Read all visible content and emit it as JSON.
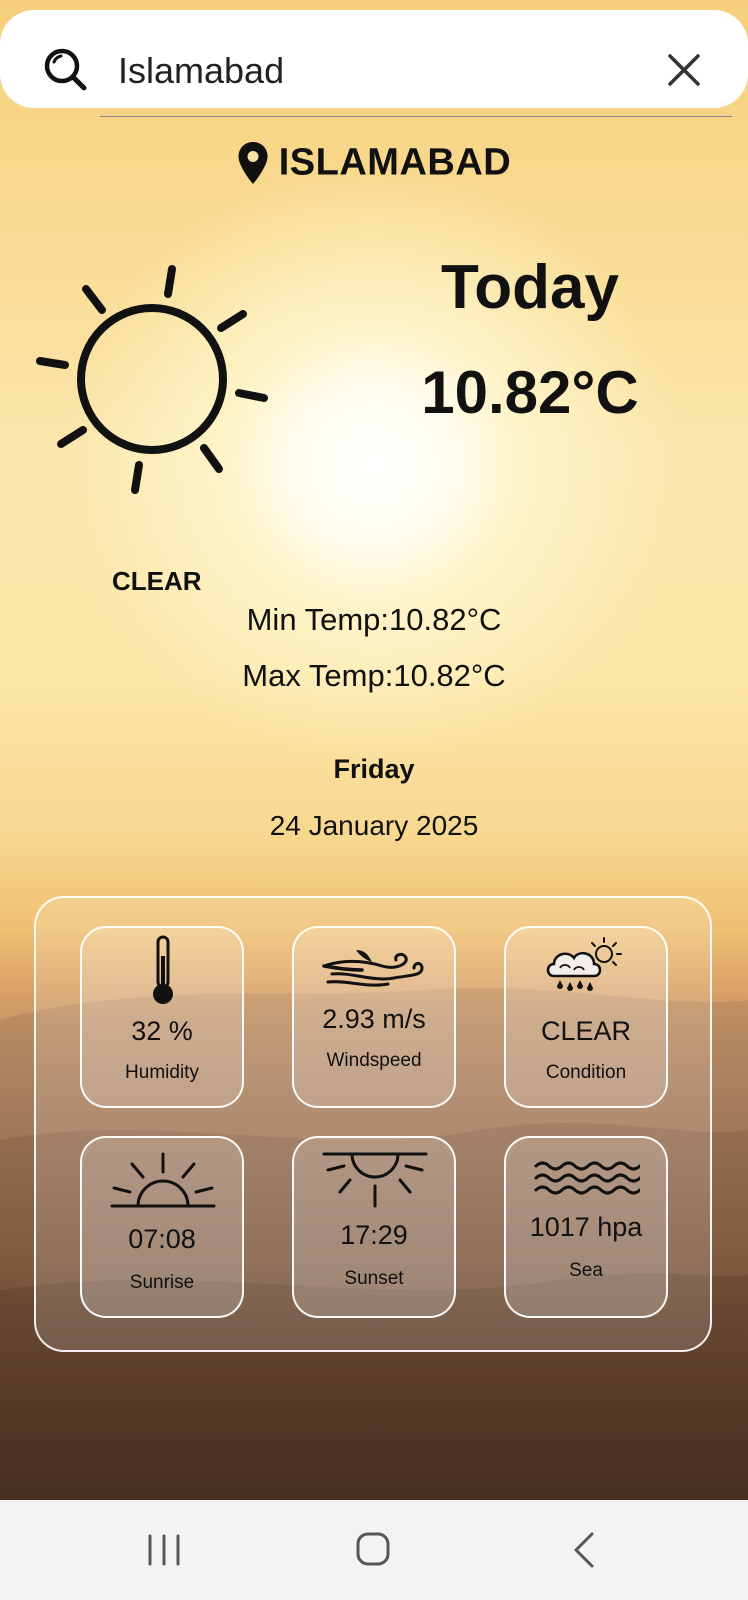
{
  "search": {
    "value": "Islamabad"
  },
  "location": {
    "city": "ISLAMABAD"
  },
  "today": {
    "label": "Today",
    "temp": "10.82°C",
    "condition": "CLEAR"
  },
  "minmax": {
    "min": "Min Temp:10.82°C",
    "max": "Max Temp:10.82°C"
  },
  "date": {
    "day": "Friday",
    "full": "24 January 2025"
  },
  "stats": {
    "humidity": {
      "value": "32 %",
      "label": "Humidity"
    },
    "windspeed": {
      "value": "2.93 m/s",
      "label": "Windspeed"
    },
    "condition": {
      "value": "CLEAR",
      "label": "Condition"
    },
    "sunrise": {
      "value": "07:08",
      "label": "Sunrise"
    },
    "sunset": {
      "value": "17:29",
      "label": "Sunset"
    },
    "sea": {
      "value": "1017 hpa",
      "label": "Sea"
    }
  },
  "icons": {
    "search": "search-icon",
    "clear": "close-icon",
    "pin": "location-pin-icon",
    "weather": "sun-icon",
    "humidity": "thermometer-icon",
    "wind": "wind-icon",
    "condition": "cloud-rain-sun-icon",
    "sunrise": "sunrise-icon",
    "sunset": "sunset-icon",
    "sea": "waves-icon",
    "nav": [
      "recent-apps-icon",
      "home-icon",
      "back-icon"
    ]
  },
  "colors": {
    "text": "#111111",
    "searchBg": "#ffffff",
    "navBg": "#f3f3f3"
  }
}
